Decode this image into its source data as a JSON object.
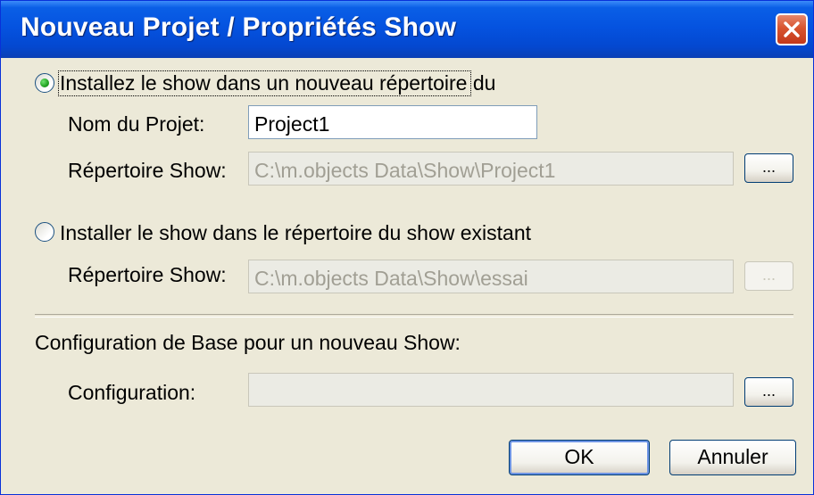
{
  "window": {
    "title": "Nouveau Projet / Propriétés Show",
    "close_icon": "close-icon"
  },
  "option_new": {
    "label": "Installez le show dans un nouveau répertoire du",
    "selected": true,
    "project_name_label": "Nom du Projet:",
    "project_name_value": "Project1",
    "directory_label": "Répertoire Show:",
    "directory_value": "C:\\m.objects Data\\Show\\Project1",
    "browse_label": "..."
  },
  "option_existing": {
    "label": "Installer le show dans le répertoire du show existant",
    "selected": false,
    "directory_label": "Répertoire Show:",
    "directory_value": "C:\\m.objects Data\\Show\\essai",
    "browse_label": "..."
  },
  "base_config": {
    "heading": "Configuration de Base pour un nouveau Show:",
    "config_label": "Configuration:",
    "config_value": "",
    "browse_label": "..."
  },
  "buttons": {
    "ok": "OK",
    "cancel": "Annuler"
  },
  "colors": {
    "titlebar": "#0553e0",
    "face": "#ece9d8",
    "close": "#d8542f",
    "radio_dot": "#21a121"
  }
}
